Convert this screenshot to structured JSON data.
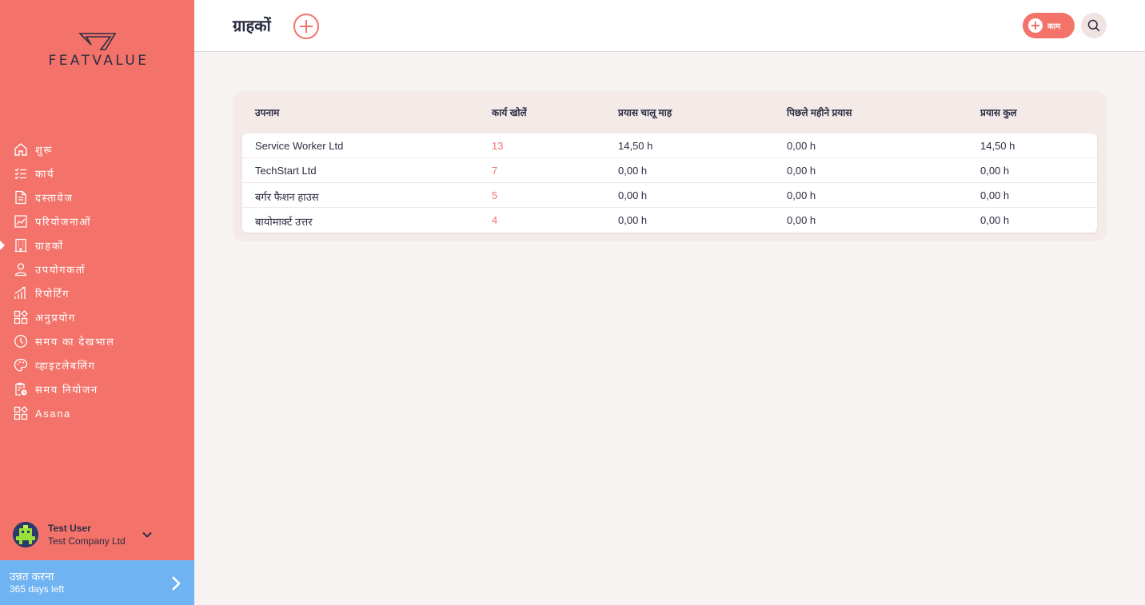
{
  "brand": {
    "logo_text": "FEATVALUE"
  },
  "sidebar": {
    "items": [
      {
        "label": "शुरू",
        "icon": "home-icon"
      },
      {
        "label": "कार्य",
        "icon": "task-list-icon"
      },
      {
        "label": "दस्तावेज",
        "icon": "document-icon"
      },
      {
        "label": "परियोजनाओं",
        "icon": "project-chart-icon"
      },
      {
        "label": "ग्राहकों",
        "icon": "building-icon",
        "active": true
      },
      {
        "label": "उपयोगकर्ता",
        "icon": "user-icon"
      },
      {
        "label": "रिपोर्टिंग",
        "icon": "reporting-icon"
      },
      {
        "label": "अनुप्रयोग",
        "icon": "apps-icon"
      },
      {
        "label": "समय का देखभाल",
        "icon": "timer-icon"
      },
      {
        "label": "व्हाइटलेबलिंग",
        "icon": "palette-icon"
      },
      {
        "label": "समय नियोजन",
        "icon": "schedule-icon"
      },
      {
        "label": "Asana",
        "icon": "apps-icon"
      }
    ],
    "user": {
      "name": "Test User",
      "company": "Test Company Ltd"
    },
    "upgrade": {
      "title": "उन्नत करना",
      "subtitle": "365 days left"
    }
  },
  "header": {
    "title": "ग्राहकों",
    "task_button_label": "काम"
  },
  "table": {
    "columns": [
      "उपनाम",
      "कार्य खोलें",
      "प्रयास चालू माह",
      "पिछले महीने प्रयास",
      "प्रयास कुल"
    ],
    "rows": [
      {
        "name": "Service Worker Ltd",
        "open_tasks": "13",
        "effort_month": "14,50 h",
        "effort_last_month": "0,00 h",
        "effort_total": "14,50 h"
      },
      {
        "name": "TechStart Ltd",
        "open_tasks": "7",
        "effort_month": "0,00 h",
        "effort_last_month": "0,00 h",
        "effort_total": "0,00 h"
      },
      {
        "name": "बर्गर फैशन हाउस",
        "open_tasks": "5",
        "effort_month": "0,00 h",
        "effort_last_month": "0,00 h",
        "effort_total": "0,00 h"
      },
      {
        "name": "बायोमार्क्ट उत्तर",
        "open_tasks": "4",
        "effort_month": "0,00 h",
        "effort_last_month": "0,00 h",
        "effort_total": "0,00 h"
      }
    ]
  },
  "colors": {
    "accent": "#f3736a",
    "upgrade": "#6fb3f2",
    "text": "#2b2d42",
    "background": "#f7f3f2"
  }
}
